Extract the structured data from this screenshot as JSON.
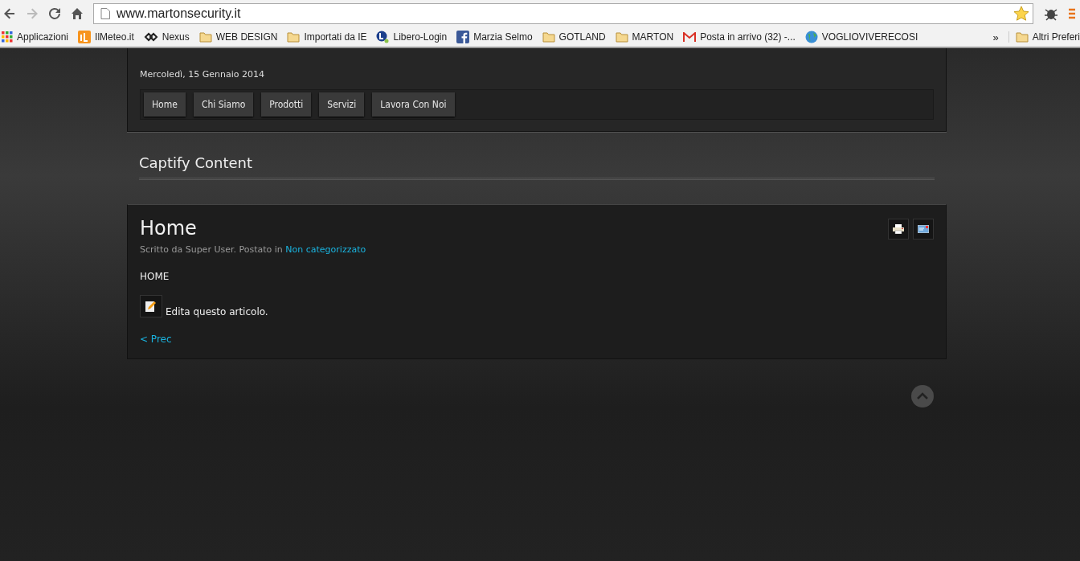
{
  "browser": {
    "url": "www.martonsecurity.it",
    "bookmarks": [
      {
        "label": "Applicazioni",
        "kind": "apps"
      },
      {
        "label": "IlMeteo.it",
        "kind": "meteo"
      },
      {
        "label": "Nexus",
        "kind": "nexus"
      },
      {
        "label": "WEB DESIGN",
        "kind": "folder"
      },
      {
        "label": "Importati da IE",
        "kind": "folder"
      },
      {
        "label": "Libero-Login",
        "kind": "libero"
      },
      {
        "label": "Marzia Selmo",
        "kind": "facebook"
      },
      {
        "label": "GOTLAND",
        "kind": "folder"
      },
      {
        "label": "MARTON",
        "kind": "folder"
      },
      {
        "label": "Posta in arrivo (32) -...",
        "kind": "mail"
      },
      {
        "label": "VOGLIOVIVERECOSI",
        "kind": "globe"
      }
    ],
    "overflow": "»",
    "other_bookmarks": "Altri Preferi"
  },
  "header": {
    "date": "Mercoledì, 15 Gennaio 2014",
    "nav": [
      "Home",
      "Chi Siamo",
      "Prodotti",
      "Servizi",
      "Lavora Con Noi"
    ]
  },
  "module_title": "Captify Content",
  "article": {
    "title": "Home",
    "byline": "Scritto da Super User. Postato in",
    "category": "Non categorizzato",
    "body": "HOME",
    "edit": "Edita questo articolo.",
    "prev": "< Prec"
  }
}
